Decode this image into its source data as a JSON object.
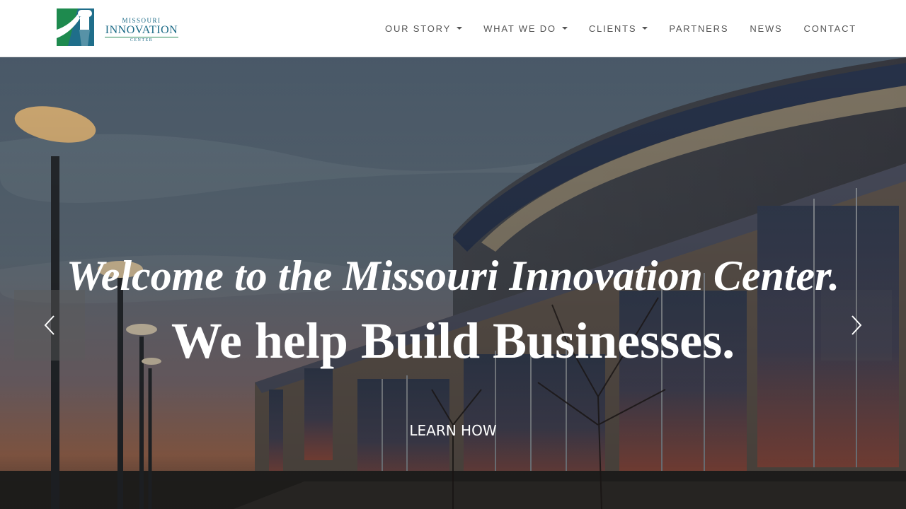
{
  "brand": {
    "line1": "MISSOURI",
    "line2": "INNOVATION",
    "line3": "CENTER"
  },
  "nav": {
    "items": [
      {
        "label": "OUR STORY",
        "dropdown": true
      },
      {
        "label": "WHAT WE DO",
        "dropdown": true
      },
      {
        "label": "CLIENTS",
        "dropdown": true
      },
      {
        "label": "PARTNERS",
        "dropdown": false
      },
      {
        "label": "NEWS",
        "dropdown": false
      },
      {
        "label": "CONTACT",
        "dropdown": false
      }
    ]
  },
  "hero": {
    "tagline": "Welcome to the Missouri Innovation Center.",
    "headline": "We help Build Businesses.",
    "cta_label": "LEARN HOW",
    "prev_icon": "chevron-left-icon",
    "next_icon": "chevron-right-icon"
  },
  "colors": {
    "brand_teal": "#1b6a86",
    "brand_green": "#2b8a5a",
    "nav_text": "#555555"
  }
}
